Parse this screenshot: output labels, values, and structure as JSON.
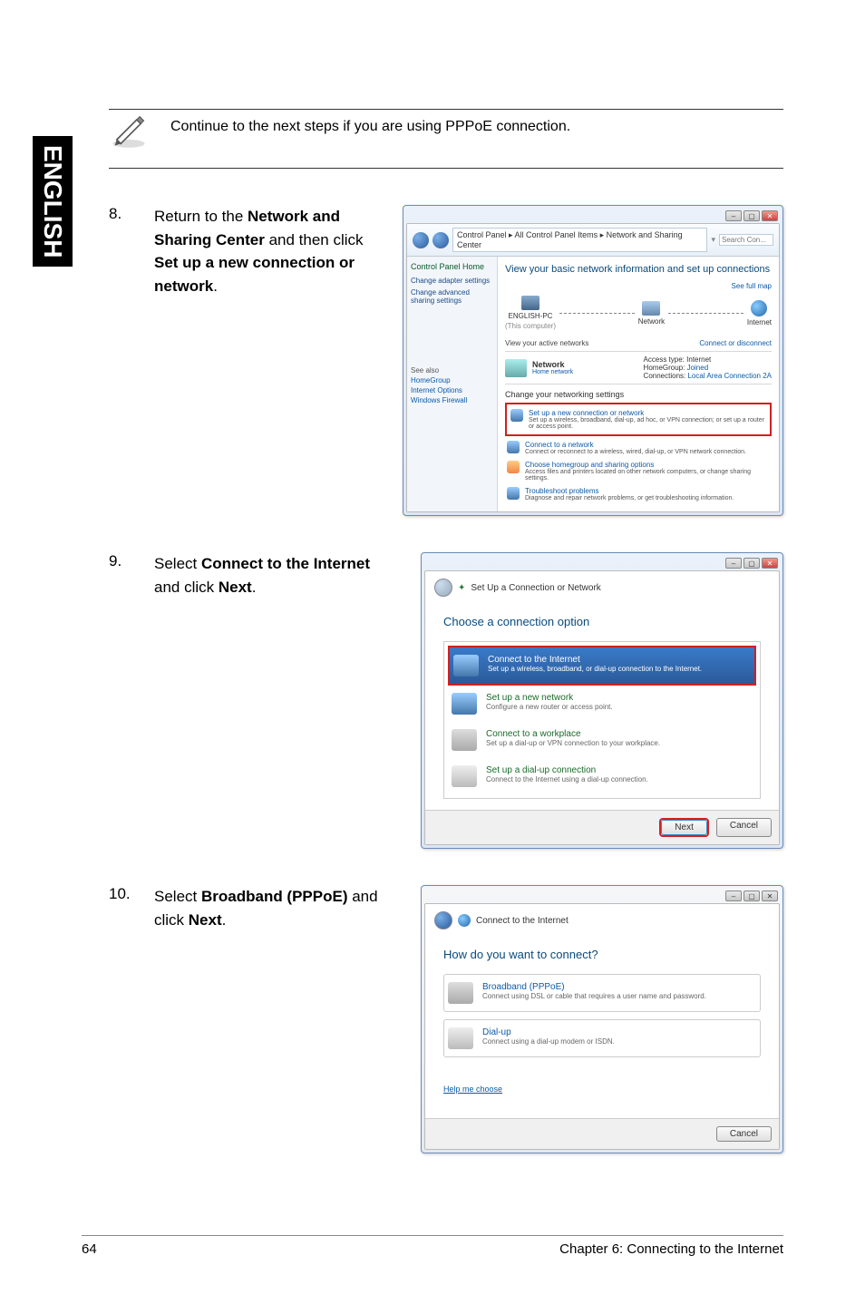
{
  "sidebar_label": "ENGLISH",
  "note": {
    "text": "Continue to the next steps if you are using PPPoE connection."
  },
  "step8": {
    "num": "8.",
    "pre": "Return to the ",
    "b1": "Network and Sharing Center",
    "mid": " and then click ",
    "b2": "Set up a new connection or network",
    "post": "."
  },
  "step9": {
    "num": "9.",
    "pre": "Select ",
    "b1": "Connect to the Internet",
    "mid": " and click ",
    "b2": "Next",
    "post": "."
  },
  "step10": {
    "num": "10.",
    "pre": "Select ",
    "b1": "Broadband (PPPoE)",
    "mid": " and click ",
    "b2": "Next",
    "post": "."
  },
  "ns_window": {
    "breadcrumb": "Control Panel  ▸  All Control Panel Items  ▸  Network and Sharing Center",
    "search_placeholder": "Search Con...",
    "left": {
      "home": "Control Panel Home",
      "adapter": "Change adapter settings",
      "advanced": "Change advanced sharing settings",
      "seealso": "See also",
      "hg": "HomeGroup",
      "io": "Internet Options",
      "wf": "Windows Firewall"
    },
    "heading": "View your basic network information and set up connections",
    "fullmap": "See full map",
    "node_pc": "ENGLISH-PC",
    "node_pc_sub": "(This computer)",
    "node_net": "Network",
    "node_inet": "Internet",
    "active_label": "View your active networks",
    "conn_disc": "Connect or disconnect",
    "net_name": "Network",
    "net_type": "Home network",
    "kv_access": "Access type:",
    "kv_access_v": "Internet",
    "kv_hg": "HomeGroup:",
    "kv_hg_v": "Joined",
    "kv_conn": "Connections:",
    "kv_conn_v": "Local Area Connection 2A",
    "change_hdr": "Change your networking settings",
    "opt1_t": "Set up a new connection or network",
    "opt1_d": "Set up a wireless, broadband, dial-up, ad hoc, or VPN connection; or set up a router or access point.",
    "opt2_t": "Connect to a network",
    "opt2_d": "Connect or reconnect to a wireless, wired, dial-up, or VPN network connection.",
    "opt3_t": "Choose homegroup and sharing options",
    "opt3_d": "Access files and printers located on other network computers, or change sharing settings.",
    "opt4_t": "Troubleshoot problems",
    "opt4_d": "Diagnose and repair network problems, or get troubleshooting information."
  },
  "wiz1": {
    "title": "Set Up a Connection or Network",
    "q": "Choose a connection option",
    "o1_t": "Connect to the Internet",
    "o1_d": "Set up a wireless, broadband, or dial-up connection to the Internet.",
    "o2_t": "Set up a new network",
    "o2_d": "Configure a new router or access point.",
    "o3_t": "Connect to a workplace",
    "o3_d": "Set up a dial-up or VPN connection to your workplace.",
    "o4_t": "Set up a dial-up connection",
    "o4_d": "Connect to the Internet using a dial-up connection.",
    "next": "Next",
    "cancel": "Cancel"
  },
  "wiz2": {
    "title": "Connect to the Internet",
    "q": "How do you want to connect?",
    "o1_t": "Broadband (PPPoE)",
    "o1_d": "Connect using DSL or cable that requires a user name and password.",
    "o2_t": "Dial-up",
    "o2_d": "Connect using a dial-up modem or ISDN.",
    "help": "Help me choose",
    "cancel": "Cancel"
  },
  "footer": {
    "page": "64",
    "chapter": "Chapter 6: Connecting to the Internet"
  }
}
